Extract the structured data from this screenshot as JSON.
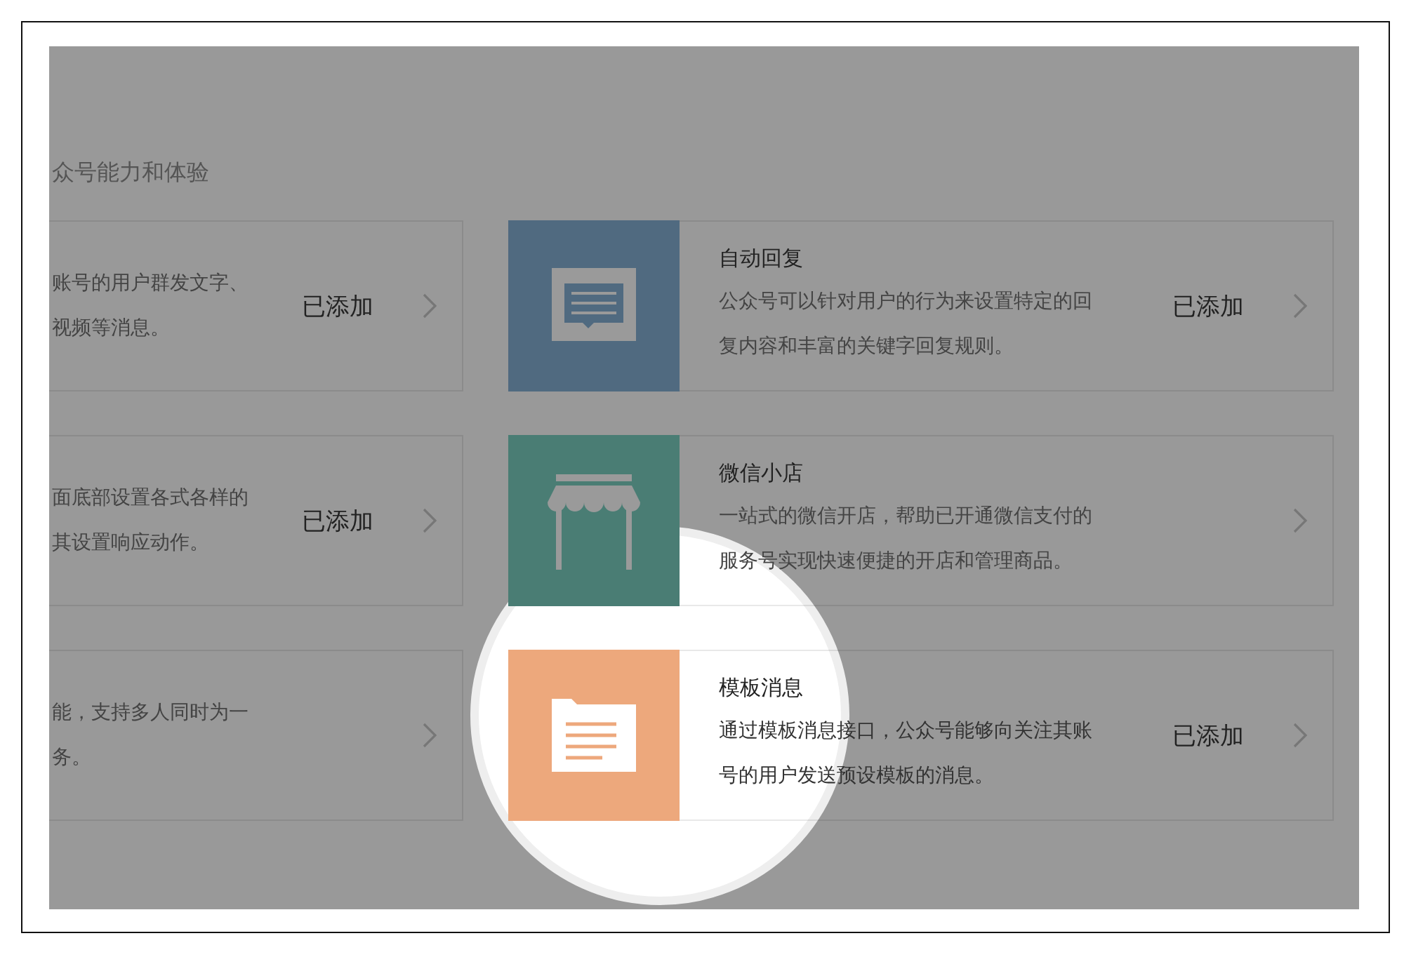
{
  "section_title": "众号能力和体验",
  "cards": [
    {
      "kind": "cut",
      "lines": [
        "账号的用户群发文字、",
        "视频等消息。"
      ],
      "status": "已添加",
      "highlighted": false
    },
    {
      "kind": "reply",
      "color": "#506a80",
      "title": "自动回复",
      "lines": [
        "公众号可以针对用户的行为来设置特定的回",
        "复内容和丰富的关键字回复规则。"
      ],
      "status": "已添加",
      "highlighted": false
    },
    {
      "kind": "cut",
      "lines": [
        "面底部设置各式各样的",
        "其设置响应动作。"
      ],
      "status": "已添加",
      "highlighted": false
    },
    {
      "kind": "shop",
      "color": "#4a7d74",
      "title": "微信小店",
      "lines": [
        "一站式的微信开店，帮助已开通微信支付的",
        "服务号实现快速便捷的开店和管理商品。"
      ],
      "highlighted": false
    },
    {
      "kind": "cut",
      "lines": [
        "能，支持多人同时为一",
        "务。"
      ],
      "highlighted": false
    },
    {
      "kind": "template",
      "color": "#eda87c",
      "title": "模板消息",
      "lines": [
        "通过模板消息接口，公众号能够向关注其账",
        "号的用户发送预设模板的消息。"
      ],
      "status": "已添加",
      "highlighted": true
    }
  ]
}
